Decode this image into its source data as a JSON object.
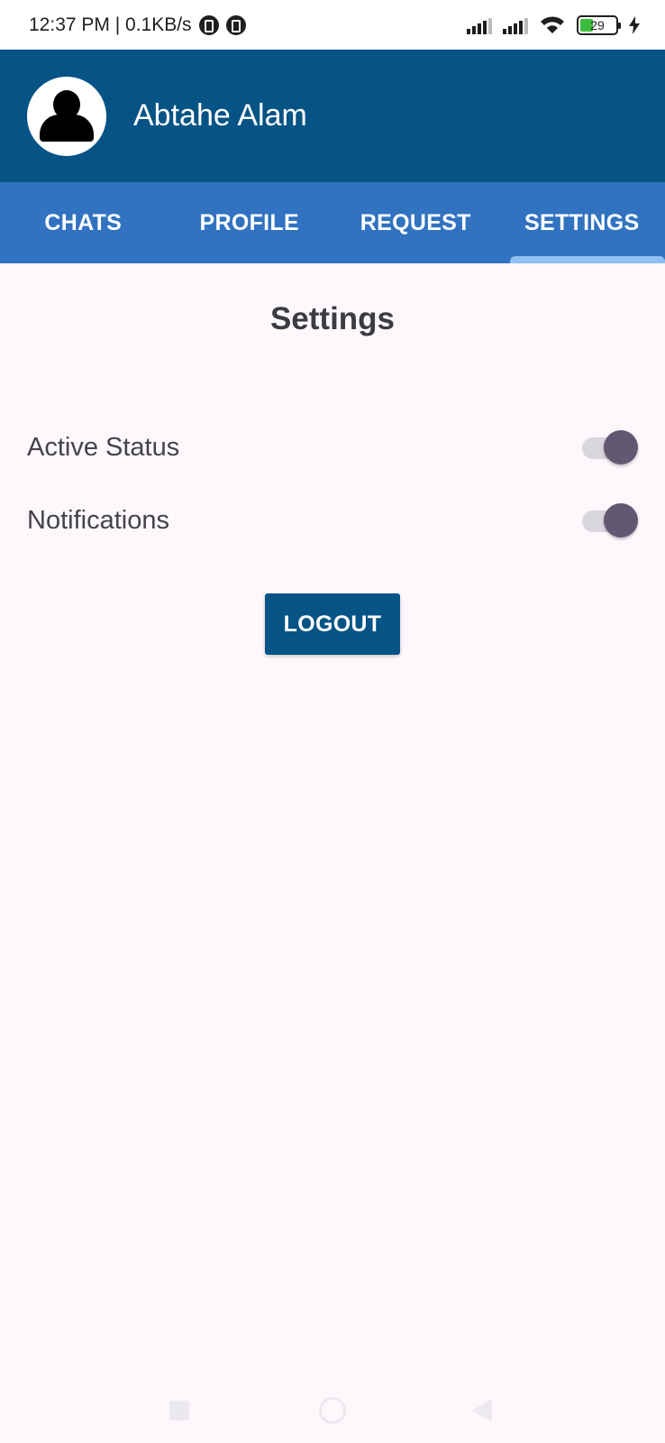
{
  "status_bar": {
    "time_speed": "12:37 PM | 0.1KB/s",
    "battery_level": "29",
    "icons": [
      "notification-icon",
      "notification-icon",
      "signal-icon",
      "signal-icon",
      "wifi-icon",
      "battery-icon",
      "charging-icon"
    ]
  },
  "header": {
    "user_name": "Abtahe Alam",
    "avatar_icon": "person-icon"
  },
  "tabs": [
    {
      "label": "CHATS",
      "active": false
    },
    {
      "label": "PROFILE",
      "active": false
    },
    {
      "label": "REQUEST",
      "active": false
    },
    {
      "label": "SETTINGS",
      "active": true
    }
  ],
  "settings": {
    "title": "Settings",
    "items": [
      {
        "label": "Active Status",
        "enabled": true
      },
      {
        "label": "Notifications",
        "enabled": true
      }
    ],
    "logout_label": "LOGOUT"
  },
  "colors": {
    "header": "#065385",
    "tabs": "#3173C0",
    "tab_indicator": "#8FC1F2",
    "switch_thumb": "#615872",
    "background": "#FCF8FC"
  },
  "nav_bar": {
    "icons": [
      "recents-icon",
      "home-icon",
      "back-icon"
    ]
  }
}
